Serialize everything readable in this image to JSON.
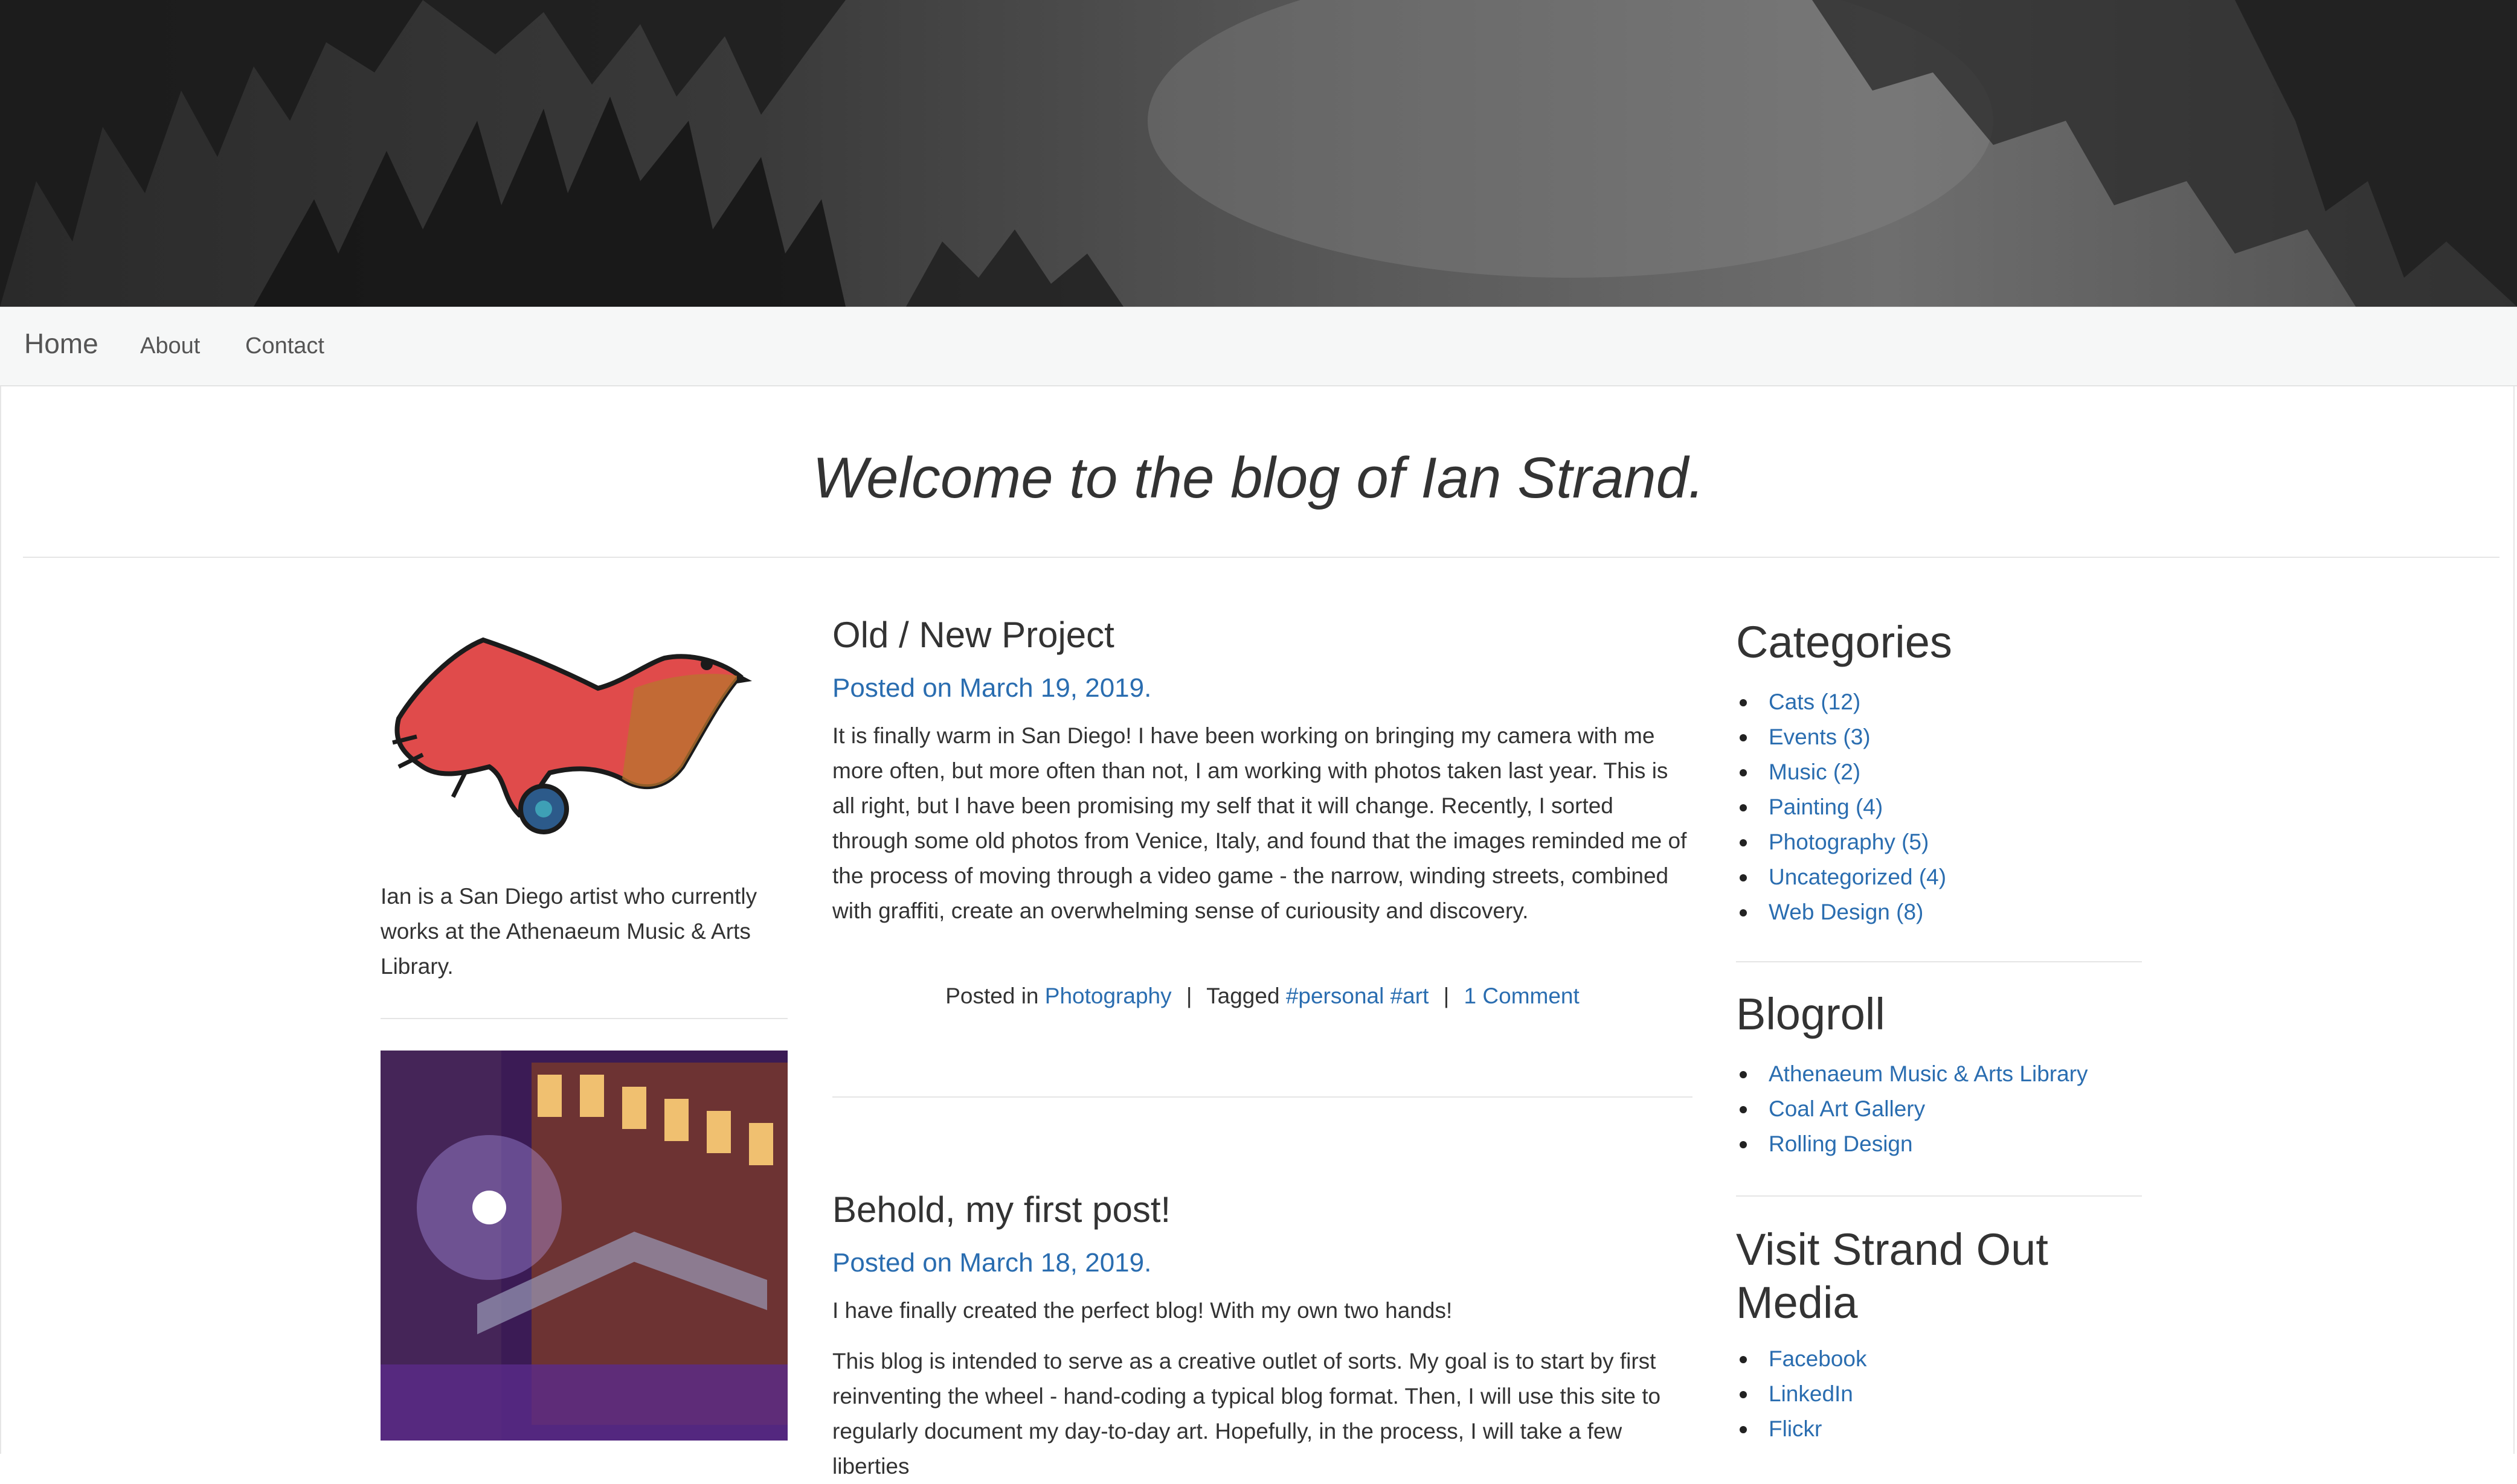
{
  "nav": {
    "home": "Home",
    "about": "About",
    "contact": "Contact"
  },
  "welcome": "Welcome to the blog of Ian Strand.",
  "sidebar_left": {
    "about": "Ian is a San Diego artist who currently works at the Athenaeum Music & Arts Library."
  },
  "posts": [
    {
      "title": "Old / New Project",
      "date": "Posted on March 19, 2019.",
      "body": "It is finally warm in San Diego! I have been working on bringing my camera with me more often, but more often than not, I am working with photos taken last year. This is all right, but I have been promising my self that it will change. Recently, I sorted through some old photos from Venice, Italy, and found that the images reminded me of the process of moving through a video game - the narrow, winding streets, combined with graffiti, create an overwhelming sense of curiousity and discovery.",
      "meta": {
        "posted_in_label": "Posted in",
        "category": "Photography",
        "tagged_label": "Tagged",
        "tags": "#personal #art",
        "comments": "1 Comment"
      }
    },
    {
      "title": "Behold, my first post!",
      "date": "Posted on March 18, 2019.",
      "intro": "I have finally created the perfect blog! With my own two hands!",
      "body": "This blog is intended to serve as a creative outlet of sorts. My goal is to start by first reinventing the wheel - hand-coding a typical blog format. Then, I will use this site to regularly document my day-to-day art. Hopefully, in the process, I will take a few liberties"
    }
  ],
  "widgets": {
    "categories": {
      "title": "Categories",
      "items": [
        "Cats (12)",
        "Events (3)",
        "Music (2)",
        "Painting (4)",
        "Photography (5)",
        "Uncategorized (4)",
        "Web Design (8)"
      ]
    },
    "blogroll": {
      "title": "Blogroll",
      "items": [
        "Athenaeum Music & Arts Library",
        "Coal Art Gallery",
        "Rolling Design"
      ]
    },
    "social": {
      "title": "Visit Strand Out Media",
      "items": [
        "Facebook",
        "LinkedIn",
        "Flickr"
      ]
    }
  },
  "colors": {
    "link": "#2a6db0",
    "text": "#333333",
    "navbar_bg": "#f6f7f7"
  }
}
